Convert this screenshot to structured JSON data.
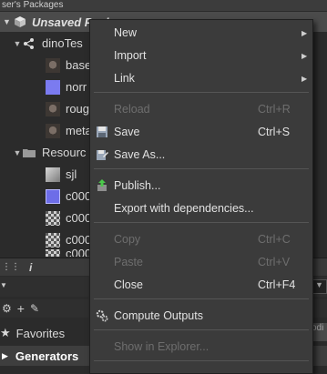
{
  "window": {
    "title": "ser's Packages"
  },
  "package": {
    "title": "Unsaved Package"
  },
  "tree": {
    "group1": "dinoTes",
    "items1": [
      "base",
      "norr",
      "roug",
      "meta"
    ],
    "group2": "Resourc",
    "items2": [
      "sjl",
      "c000",
      "c000",
      "c000",
      "c000"
    ]
  },
  "bottom": {
    "info_label": "i",
    "favorites": "Favorites",
    "generators": "Generators",
    "right_text": "odi"
  },
  "menu": {
    "items": [
      {
        "label": "New",
        "shortcut": "",
        "submenu": true,
        "enabled": true
      },
      {
        "label": "Import",
        "shortcut": "",
        "submenu": true,
        "enabled": true
      },
      {
        "label": "Link",
        "shortcut": "",
        "submenu": true,
        "enabled": true
      },
      {
        "label": "Reload",
        "shortcut": "Ctrl+R",
        "enabled": false
      },
      {
        "label": "Save",
        "shortcut": "Ctrl+S",
        "enabled": true,
        "icon": "save-icon"
      },
      {
        "label": "Save As...",
        "shortcut": "",
        "enabled": true,
        "icon": "save-as-icon"
      },
      {
        "label": "Publish...",
        "shortcut": "",
        "enabled": true,
        "icon": "publish-icon"
      },
      {
        "label": "Export with dependencies...",
        "shortcut": "",
        "enabled": true
      },
      {
        "label": "Copy",
        "shortcut": "Ctrl+C",
        "enabled": false
      },
      {
        "label": "Paste",
        "shortcut": "Ctrl+V",
        "enabled": false
      },
      {
        "label": "Close",
        "shortcut": "Ctrl+F4",
        "enabled": true
      },
      {
        "label": "Compute Outputs",
        "shortcut": "",
        "enabled": true,
        "icon": "gears-icon"
      },
      {
        "label": "Show in Explorer...",
        "shortcut": "",
        "enabled": false
      }
    ]
  }
}
